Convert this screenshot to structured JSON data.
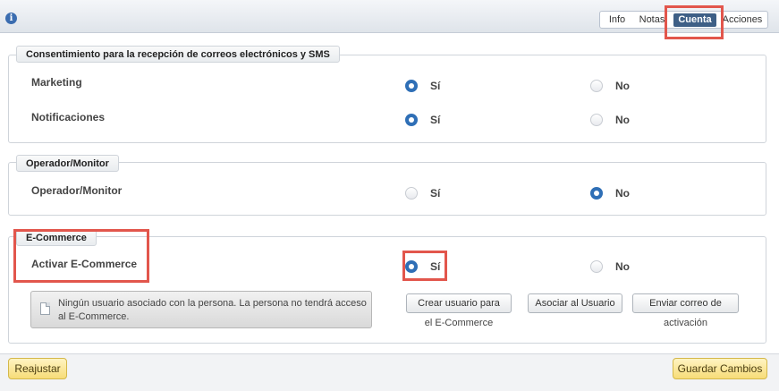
{
  "header": {
    "info_icon": "i",
    "tabs": [
      {
        "label": "Info"
      },
      {
        "label": "Notas"
      },
      {
        "label": "Cuenta",
        "active": true
      },
      {
        "label": "Acciones"
      }
    ]
  },
  "sections": {
    "consent": {
      "legend": "Consentimiento para la recepción de correos electrónicos y SMS",
      "rows": [
        {
          "label": "Marketing",
          "yes": "Sí",
          "no": "No",
          "selected": "yes"
        },
        {
          "label": "Notificaciones",
          "yes": "Sí",
          "no": "No",
          "selected": "yes"
        }
      ]
    },
    "operator": {
      "legend": "Operador/Monitor",
      "rows": [
        {
          "label": "Operador/Monitor",
          "yes": "Sí",
          "no": "No",
          "selected": "no"
        }
      ]
    },
    "ecommerce": {
      "legend": "E-Commerce",
      "rows": [
        {
          "label": "Activar E-Commerce",
          "yes": "Sí",
          "no": "No",
          "selected": "yes"
        }
      ],
      "notice": "Ningún usuario asociado con la persona. La persona no tendrá acceso al E-Commerce.",
      "buttons": {
        "create_user": "Crear usuario para",
        "create_user_sub": "el E-Commerce",
        "associate_user": "Asociar al Usuario",
        "send_activation": "Enviar correo de",
        "send_activation_sub": "activación"
      }
    }
  },
  "footer": {
    "adjust": "Reajustar",
    "save": "Guardar Cambios"
  },
  "colors": {
    "accent": "#2f6fb6",
    "active_tab": "#3e5f86",
    "highlight": "#e2564c",
    "footer_button": "#f7dc78"
  }
}
